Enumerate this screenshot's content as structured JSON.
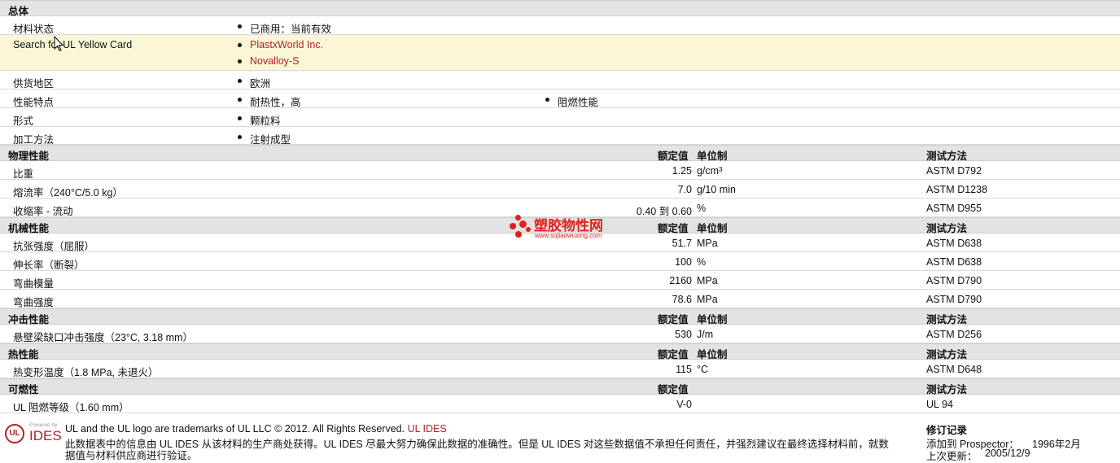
{
  "general": {
    "title": "总体",
    "material_status_label": "材料状态",
    "material_status_value": "已商用：当前有效",
    "yellow_card_label": "Search for UL Yellow Card",
    "yellow_card_links": [
      "PlastxWorld Inc.",
      "Novalloy-S"
    ],
    "supply_region_label": "供货地区",
    "supply_region_value": "欧洲",
    "features_label": "性能特点",
    "features_values": [
      "耐热性，高",
      "阻燃性能"
    ],
    "form_label": "形式",
    "form_value": "颗粒料",
    "processing_label": "加工方法",
    "processing_value": "注射成型"
  },
  "columns": {
    "nominal": "额定值",
    "unit": "单位制",
    "method": "测试方法"
  },
  "sections": {
    "physical": {
      "title": "物理性能",
      "rows": [
        {
          "name": "比重",
          "value": "1.25",
          "unit": "g/cm³",
          "method": "ASTM D792"
        },
        {
          "name": "熔流率（240°C/5.0 kg）",
          "value": "7.0",
          "unit": "g/10 min",
          "method": "ASTM D1238"
        },
        {
          "name": "收缩率 - 流动",
          "value": "0.40 到 0.60",
          "unit": "%",
          "method": "ASTM D955"
        }
      ]
    },
    "mechanical": {
      "title": "机械性能",
      "rows": [
        {
          "name": "抗张强度（屈服）",
          "value": "51.7",
          "unit": "MPa",
          "method": "ASTM D638"
        },
        {
          "name": "伸长率（断裂）",
          "value": "100",
          "unit": "%",
          "method": "ASTM D638"
        },
        {
          "name": "弯曲模量",
          "value": "2160",
          "unit": "MPa",
          "method": "ASTM D790"
        },
        {
          "name": "弯曲强度",
          "value": "78.6",
          "unit": "MPa",
          "method": "ASTM D790"
        }
      ]
    },
    "impact": {
      "title": "冲击性能",
      "rows": [
        {
          "name": "悬壁梁缺口冲击强度（23°C, 3.18 mm）",
          "value": "530",
          "unit": "J/m",
          "method": "ASTM D256"
        }
      ]
    },
    "thermal": {
      "title": "热性能",
      "rows": [
        {
          "name": "热变形温度（1.8 MPa, 未退火）",
          "value": "115",
          "unit": "°C",
          "method": "ASTM D648"
        }
      ]
    },
    "flammability": {
      "title": "可燃性",
      "rows": [
        {
          "name": "UL 阻燃等级（1.60 mm）",
          "value": "V-0",
          "unit": "",
          "method": "UL 94"
        }
      ]
    }
  },
  "watermark": {
    "name": "塑胶物性网",
    "url": "www.sujiaowuxing.com"
  },
  "footer": {
    "logo_powered": "Powered by",
    "logo_ul": "UL",
    "logo_ides": "IDES",
    "trademark": "UL and the UL logo are trademarks of UL LLC © 2012. All Rights Reserved.",
    "trademark_link": "UL IDES",
    "disclaimer_1": "此数据表中的信息由  UL IDES 从该材料的生产商处获得。UL IDES 尽最大努力确保此数据的准确性。但是  UL IDES 对这些数据值不承担任何责任，并强烈建议在最终选择材料前，就数",
    "disclaimer_2": "据值与材料供应商进行验证。",
    "revision_title": "修订记录",
    "added_label": "添加到  Prospector：",
    "added_date": "1996年2月",
    "updated_label": "上次更新：",
    "updated_date": "2005/12/9"
  },
  "colors": {
    "header_bg": "#e3e3e3",
    "link_red": "#b3202a",
    "highlight_yellow": "#fbf7d6"
  }
}
